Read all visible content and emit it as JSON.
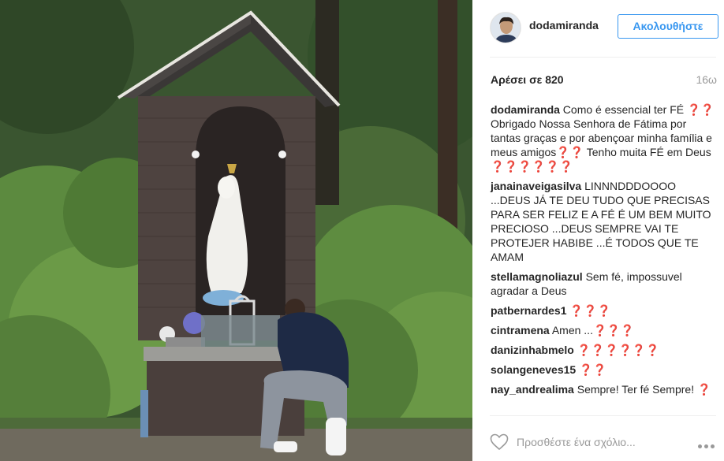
{
  "post": {
    "photo_icon": "shrine-photo",
    "author": {
      "username": "dodamiranda",
      "avatar_icon": "user-avatar"
    },
    "follow_label": "Ακολουθήστε",
    "likes_text": "Αρέσει σε 820",
    "timestamp": "16ω",
    "comments": [
      {
        "user": "dodamiranda",
        "text": "Como é essencial ter FÉ ❓❓ Obrigado Nossa Senhora de Fátima por tantas graças e por abençoar minha família e meus amigos❓❓ Tenho muita FÉ em Deus ❓❓❓❓❓❓"
      },
      {
        "user": "janainaveigasilva",
        "text": "LINNNDDDOOOO ...DEUS JÁ TE DEU TUDO QUE PRECISAS PARA SER FELIZ E A FÉ É UM BEM MUITO PRECIOSO ...DEUS SEMPRE VAI TE PROTEJER HABIBE ...É TODOS QUE TE AMAM"
      },
      {
        "user": "stellamagnoliazul",
        "text": "Sem fé, impossuvel agradar a Deus"
      },
      {
        "user": "patbernardes1",
        "text": "❓❓❓"
      },
      {
        "user": "cintramena",
        "text": "Amen ...❓❓❓"
      },
      {
        "user": "danizinhabmelo",
        "text": "❓❓❓❓❓❓"
      },
      {
        "user": "solangeneves15",
        "text": "❓❓"
      },
      {
        "user": "nay_andrealima",
        "text": "Sempre! Ter fé Sempre! ❓"
      }
    ],
    "comment_placeholder": "Προσθέστε ένα σχόλιο...",
    "icons": {
      "like": "heart-icon",
      "options": "more-options-icon"
    }
  }
}
